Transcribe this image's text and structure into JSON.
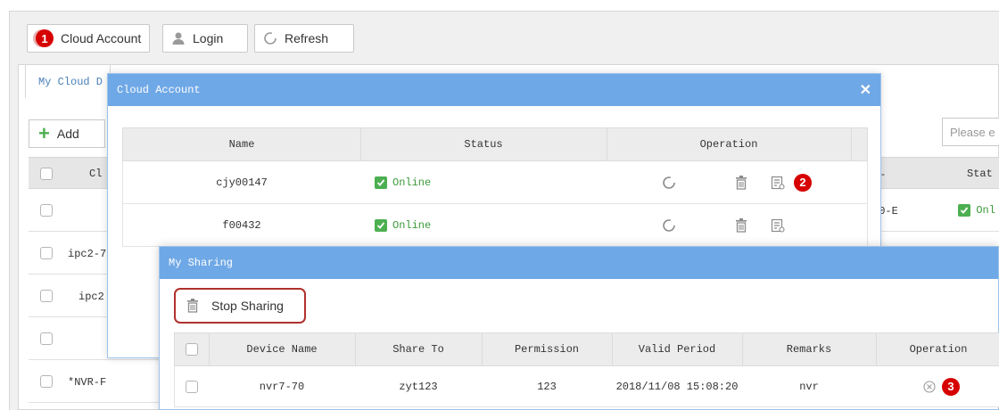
{
  "toolbar": {
    "cloud_account_label": "Cloud Account",
    "login_label": "Login",
    "refresh_label": "Refresh",
    "marker_1": "1"
  },
  "bg": {
    "tab_label": "My Cloud D",
    "add_label": "Add",
    "search_placeholder": "Please e",
    "header_col_name": "Cl",
    "header_col_status": "Stat",
    "header_col_dash": "-",
    "rows": [
      {
        "name": "",
        "type": "00-E",
        "status": "Onl"
      },
      {
        "name": "ipc2-7",
        "type": "",
        "status": ""
      },
      {
        "name": "ipc2",
        "type": "",
        "status": ""
      },
      {
        "name": "",
        "type": "",
        "status": ""
      },
      {
        "name": "*NVR-F",
        "type": "",
        "status": ""
      }
    ]
  },
  "cloud_dialog": {
    "title": "Cloud Account",
    "columns": [
      "Name",
      "Status",
      "Operation"
    ],
    "rows": [
      {
        "name": "cjy00147",
        "status": "Online"
      },
      {
        "name": "f00432",
        "status": "Online"
      }
    ],
    "marker_2": "2"
  },
  "sharing_dialog": {
    "title": "My Sharing",
    "stop_sharing_label": "Stop Sharing",
    "columns": [
      "Device Name",
      "Share To",
      "Permission",
      "Valid Period",
      "Remarks",
      "Operation"
    ],
    "rows": [
      {
        "device_name": "nvr7-70",
        "share_to": "zyt123",
        "permission": "123",
        "valid_period": "2018/11/08 15:08:20",
        "remarks": "nvr"
      }
    ],
    "marker_3": "3"
  },
  "colors": {
    "title_bar": "#6fa8e6",
    "online_green": "#4caf50",
    "marker_red": "#d60000",
    "highlight_border": "#b0312e"
  }
}
